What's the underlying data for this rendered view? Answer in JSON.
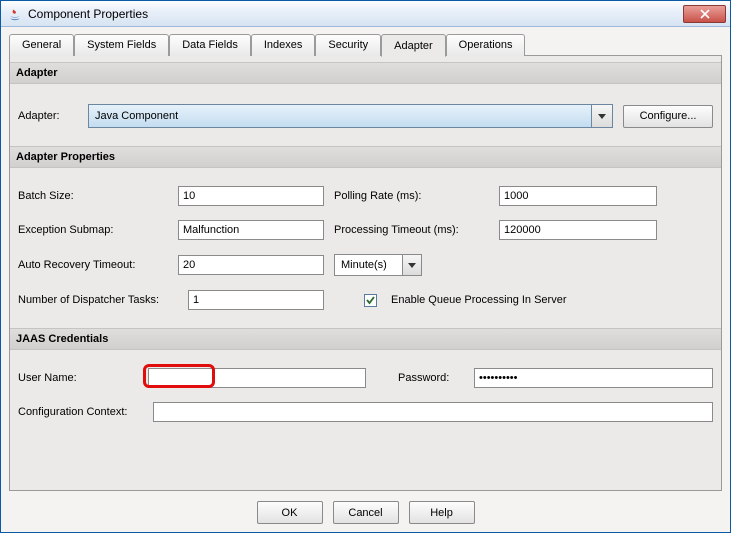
{
  "window": {
    "title": "Component Properties"
  },
  "tabs": [
    {
      "label": "General"
    },
    {
      "label": "System Fields"
    },
    {
      "label": "Data Fields"
    },
    {
      "label": "Indexes"
    },
    {
      "label": "Security"
    },
    {
      "label": "Adapter"
    },
    {
      "label": "Operations"
    }
  ],
  "adapter_section": {
    "header": "Adapter",
    "label": "Adapter:",
    "value": "Java Component",
    "configure_label": "Configure..."
  },
  "props_section": {
    "header": "Adapter Properties",
    "batch_size": {
      "label": "Batch Size:",
      "value": "10"
    },
    "polling_rate": {
      "label": "Polling Rate (ms):",
      "value": "1000"
    },
    "exception_submap": {
      "label": "Exception Submap:",
      "value": "Malfunction"
    },
    "processing_timeout": {
      "label": "Processing Timeout (ms):",
      "value": "120000"
    },
    "auto_recovery": {
      "label": "Auto Recovery Timeout:",
      "value": "20"
    },
    "time_unit": {
      "value": "Minute(s)"
    },
    "dispatcher_tasks": {
      "label": "Number of Dispatcher Tasks:",
      "value": "1"
    },
    "enable_queue": {
      "label": "Enable Queue Processing In Server",
      "checked": true
    }
  },
  "jaas_section": {
    "header": "JAAS Credentials",
    "user_name": {
      "label": "User Name:",
      "value": ""
    },
    "password": {
      "label": "Password:",
      "value": "••••••••••"
    },
    "config_context": {
      "label": "Configuration Context:",
      "value": ""
    }
  },
  "buttons": {
    "ok": "OK",
    "cancel": "Cancel",
    "help": "Help"
  }
}
